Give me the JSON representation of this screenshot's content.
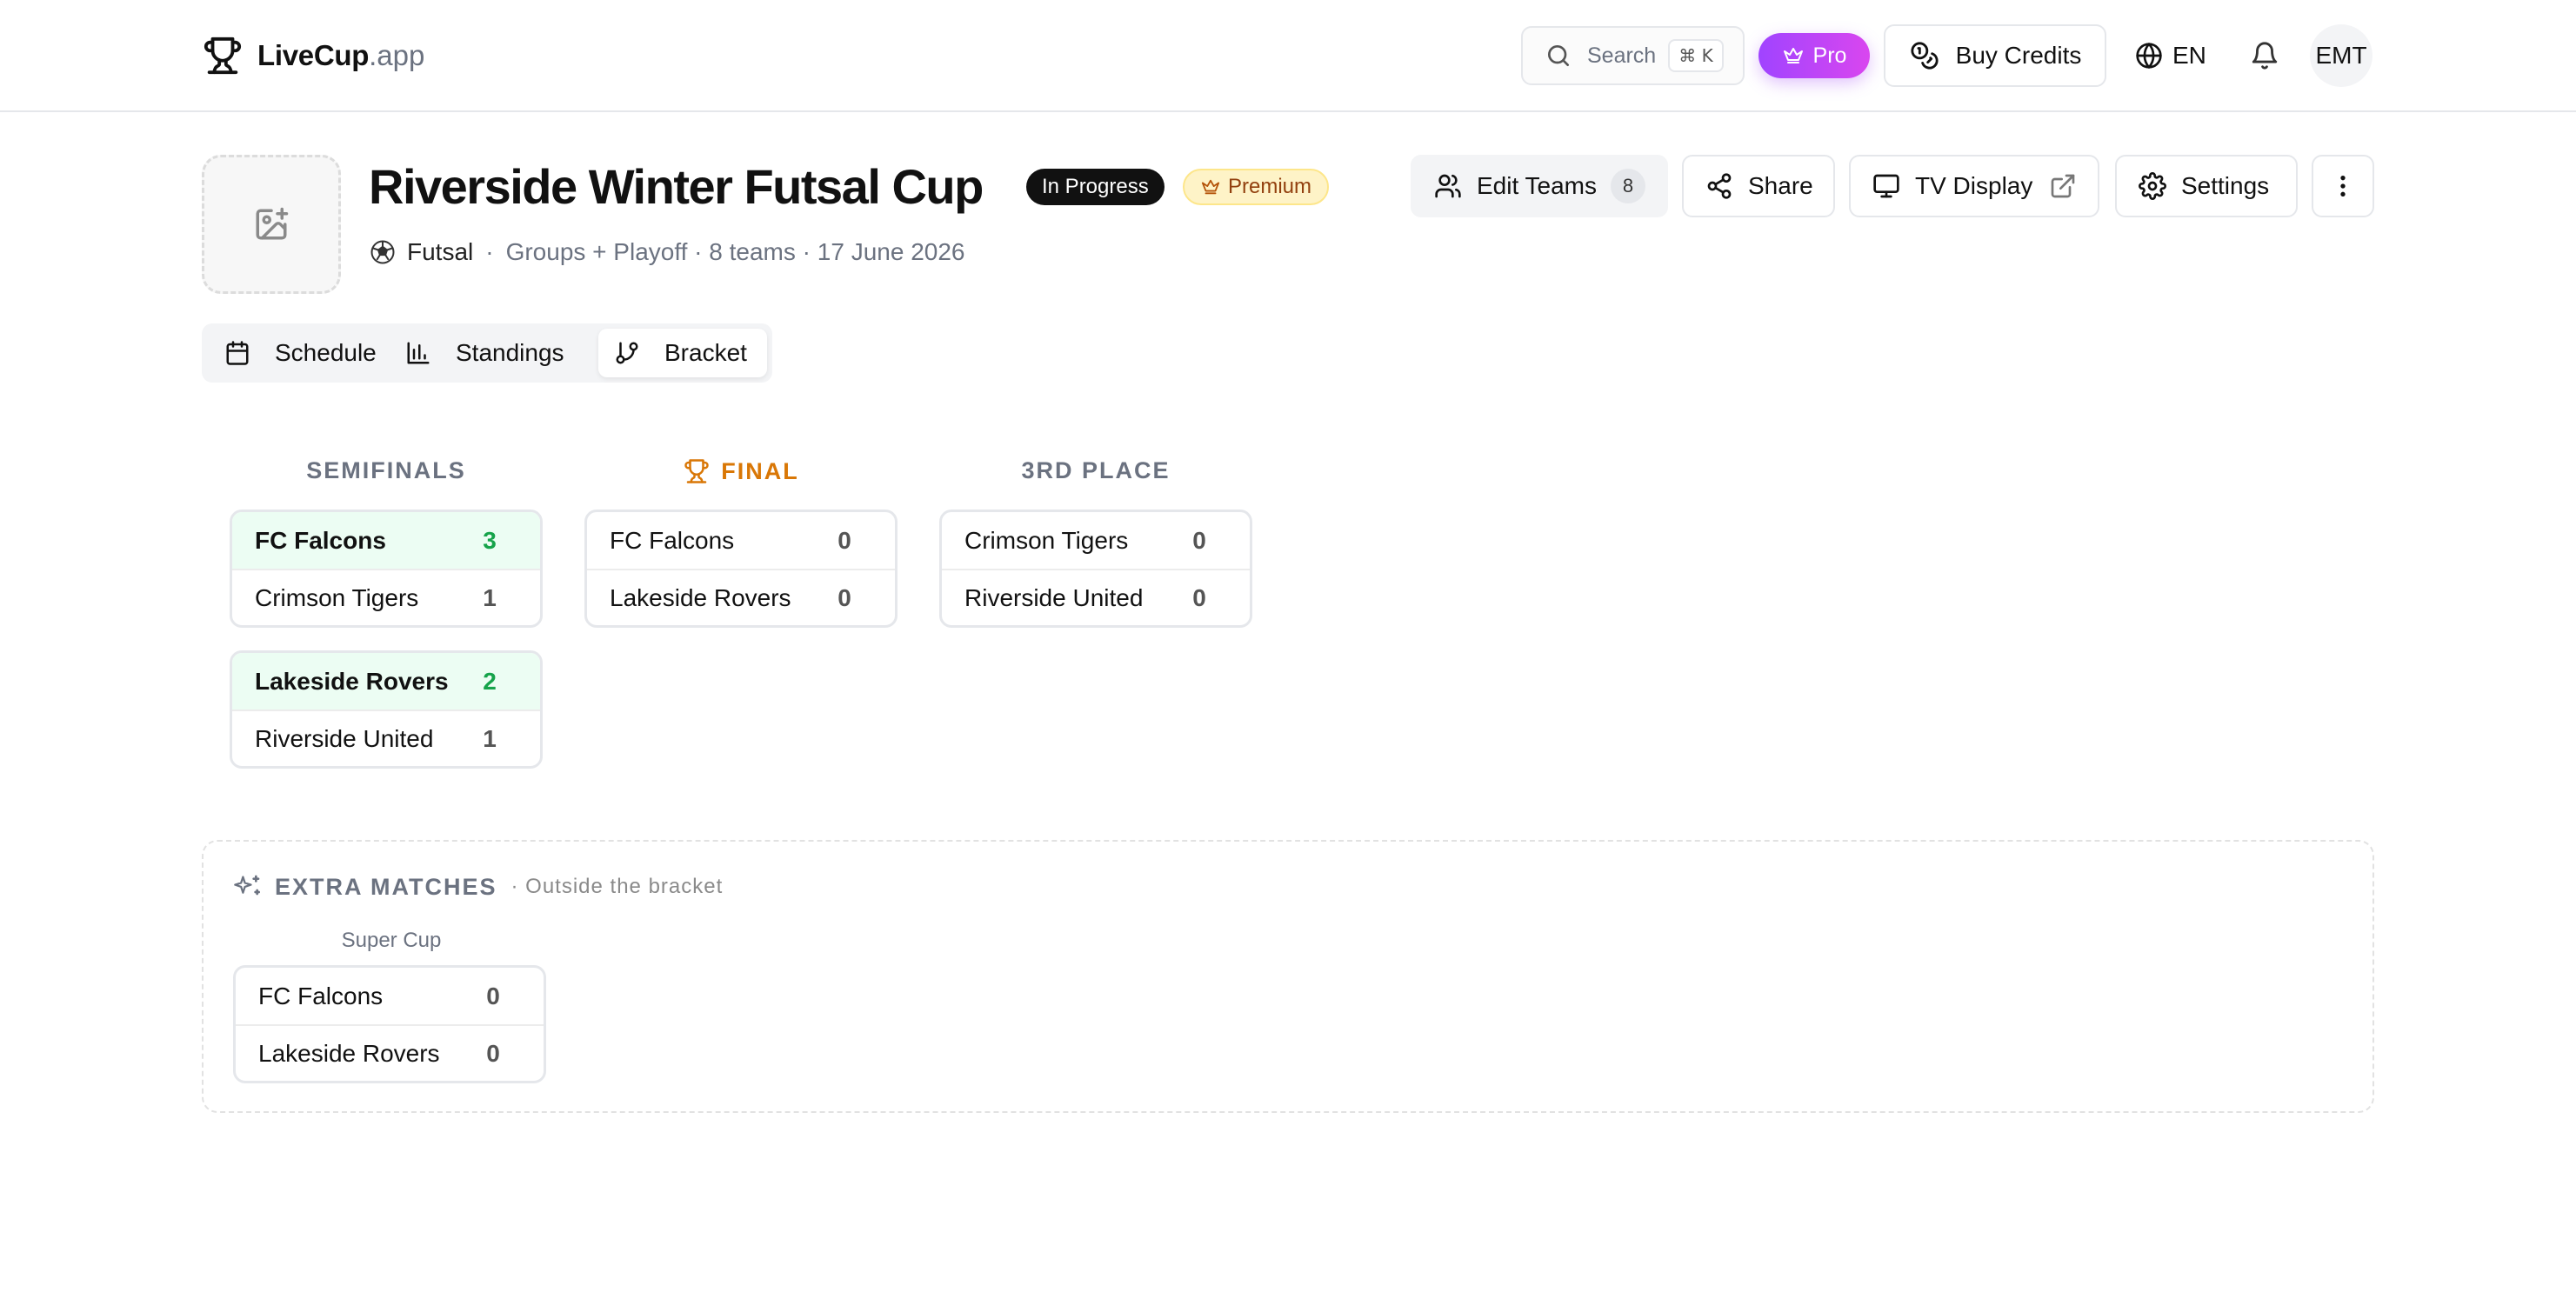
{
  "brand": {
    "name": "LiveCup",
    "suffix": ".app"
  },
  "nav": {
    "search_placeholder": "Search",
    "shortcut": "⌘ K",
    "pro_label": "Pro",
    "buy_credits_label": "Buy Credits",
    "language": "EN",
    "avatar_initials": "EMT"
  },
  "tournament": {
    "title": "Riverside Winter Futsal Cup",
    "status": "In Progress",
    "plan": "Premium",
    "sport": "Futsal",
    "details": "Groups + Playoff · 8 teams · 17 June 2026"
  },
  "actions": {
    "edit_teams": "Edit Teams",
    "team_count": "8",
    "share": "Share",
    "tv_display": "TV Display",
    "settings": "Settings"
  },
  "tabs": [
    {
      "label": "Schedule",
      "active": false
    },
    {
      "label": "Standings",
      "active": false
    },
    {
      "label": "Bracket",
      "active": true
    }
  ],
  "bracket": {
    "rounds": [
      {
        "title": "SEMIFINALS"
      },
      {
        "title": "FINAL"
      },
      {
        "title": "3RD PLACE"
      }
    ],
    "matches": [
      {
        "round": "SEMIFINALS",
        "home": {
          "team": "FC Falcons",
          "score": "3",
          "winner": true
        },
        "away": {
          "team": "Crimson Tigers",
          "score": "1",
          "winner": false
        }
      },
      {
        "round": "SEMIFINALS",
        "home": {
          "team": "Lakeside Rovers",
          "score": "2",
          "winner": true
        },
        "away": {
          "team": "Riverside United",
          "score": "1",
          "winner": false
        }
      },
      {
        "round": "FINAL",
        "home": {
          "team": "FC Falcons",
          "score": "0",
          "winner": false
        },
        "away": {
          "team": "Lakeside Rovers",
          "score": "0",
          "winner": false
        }
      },
      {
        "round": "3RD PLACE",
        "home": {
          "team": "Crimson Tigers",
          "score": "0",
          "winner": false
        },
        "away": {
          "team": "Riverside United",
          "score": "0",
          "winner": false
        }
      }
    ]
  },
  "extra": {
    "title": "EXTRA MATCHES",
    "subtitle": "· Outside the bracket",
    "match_label": "Super Cup",
    "match": {
      "home": {
        "team": "FC Falcons",
        "score": "0"
      },
      "away": {
        "team": "Lakeside Rovers",
        "score": "0"
      }
    }
  },
  "colors": {
    "accent_pro": "#a855f7",
    "winner_green": "#16a34a",
    "winner_bg": "#ecfdf3",
    "final_gold": "#d97706",
    "premium_bg": "#fef3c7"
  }
}
